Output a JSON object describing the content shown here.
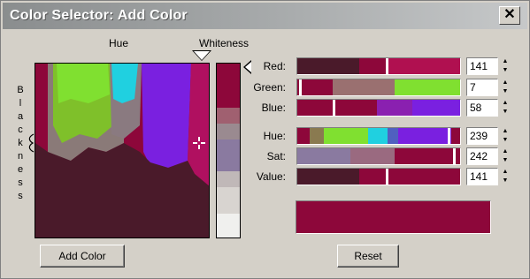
{
  "window": {
    "title": "Color Selector: Add Color",
    "close_glyph": "✕"
  },
  "labels": {
    "hue": "Hue",
    "whiteness": "Whiteness",
    "blackness_letters": [
      "B",
      "l",
      "a",
      "c",
      "k",
      "n",
      "e",
      "s",
      "s"
    ]
  },
  "sliders": [
    {
      "name": "Red:",
      "value": "141"
    },
    {
      "name": "Green:",
      "value": "7"
    },
    {
      "name": "Blue:",
      "value": "58"
    },
    {
      "name": "Hue:",
      "value": "239"
    },
    {
      "name": "Sat:",
      "value": "242"
    },
    {
      "name": "Value:",
      "value": "141"
    }
  ],
  "spinner": {
    "up_glyph": "▲",
    "down_glyph": "▼"
  },
  "buttons": {
    "add_color": "Add Color",
    "reset": "Reset"
  },
  "colors": {
    "current": "#8d073a",
    "dialog_bg": "#d4d0c8",
    "dark": "#4a1a2a",
    "green": "#80e030",
    "cyan": "#20d0e0",
    "purple": "#7a20e0",
    "gray": "#8a7a78"
  },
  "icons": {
    "close": "close-icon",
    "picker": "crosshair-icon"
  }
}
